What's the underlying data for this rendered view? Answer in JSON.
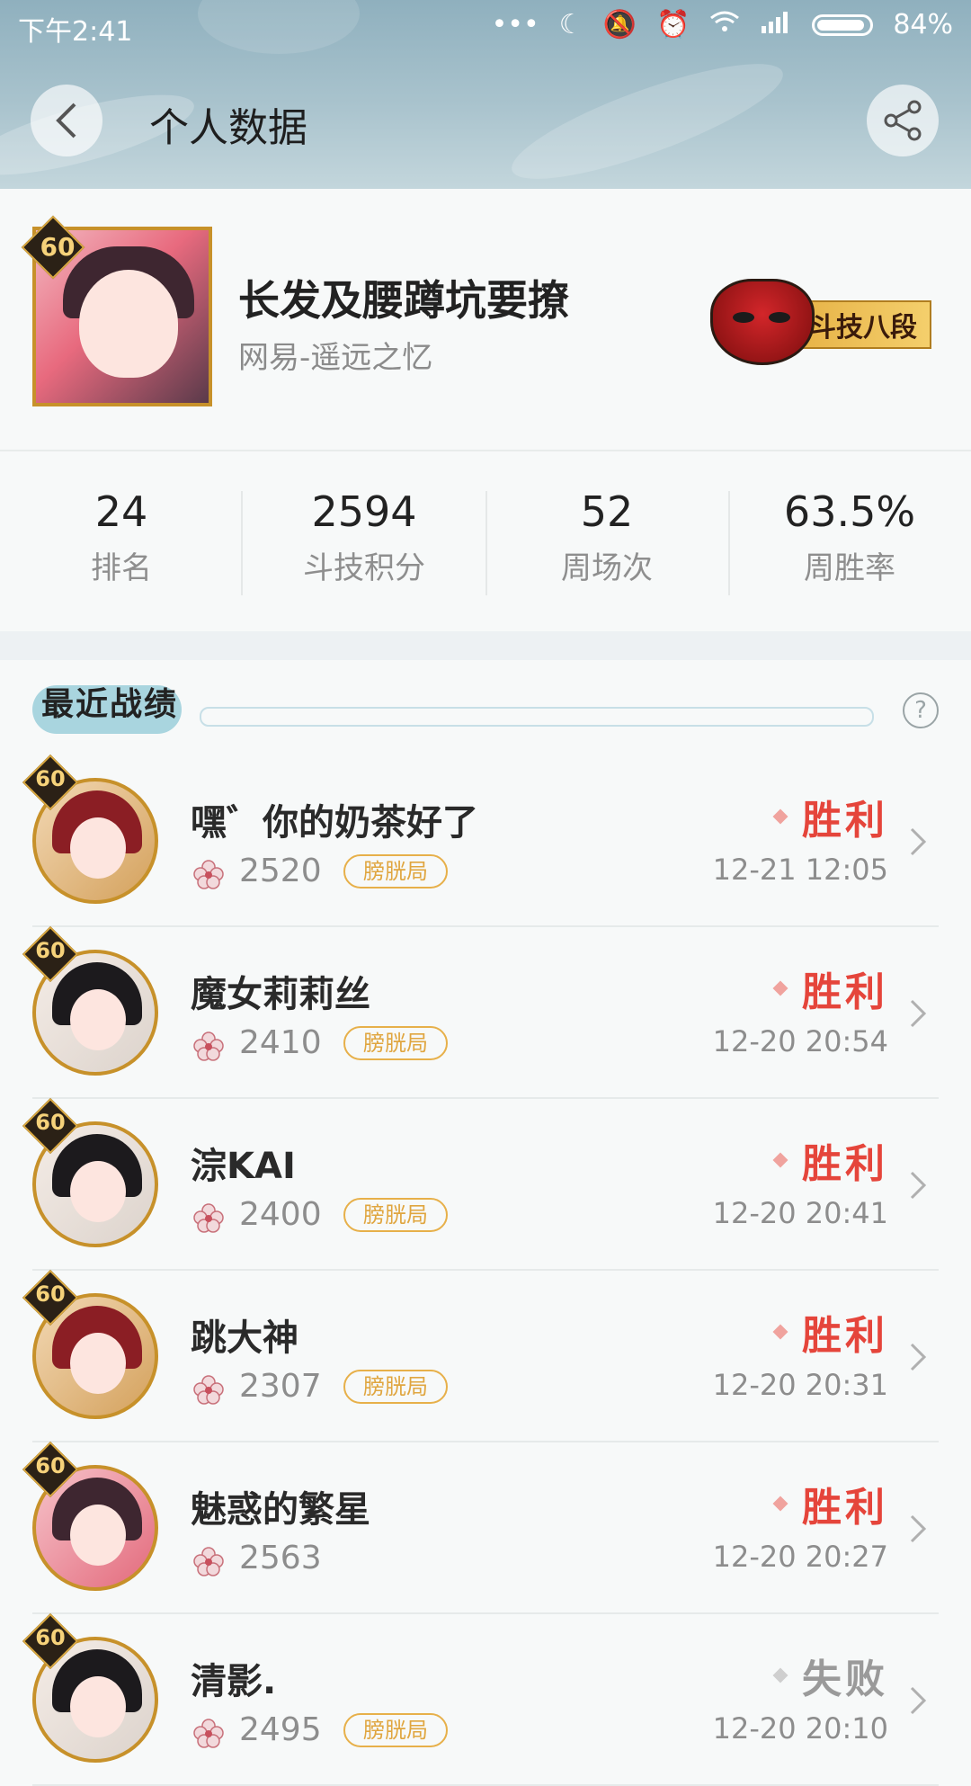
{
  "status_bar": {
    "time": "下午2:41",
    "battery": "84%"
  },
  "header": {
    "title": "个人数据"
  },
  "profile": {
    "level": "60",
    "name": "长发及腰蹲坑要撩",
    "server": "网易-遥远之忆",
    "rank": "斗技八段"
  },
  "stats": [
    {
      "value": "24",
      "label": "排名"
    },
    {
      "value": "2594",
      "label": "斗技积分"
    },
    {
      "value": "52",
      "label": "周场次"
    },
    {
      "value": "63.5%",
      "label": "周胜率"
    }
  ],
  "recent": {
    "title": "最近战绩",
    "help": "?"
  },
  "matches": [
    {
      "level": "60",
      "name": "嘿゛你的奶茶好了",
      "score": "2520",
      "tag": "膀胱局",
      "result": "胜利",
      "time": "12-21 12:05",
      "avatar": "swordsman"
    },
    {
      "level": "60",
      "name": "魔女莉莉丝",
      "score": "2410",
      "tag": "膀胱局",
      "result": "胜利",
      "time": "12-20 20:54",
      "avatar": "black-hair"
    },
    {
      "level": "60",
      "name": "淙KAI",
      "score": "2400",
      "tag": "膀胱局",
      "result": "胜利",
      "time": "12-20 20:41",
      "avatar": "black-hair"
    },
    {
      "level": "60",
      "name": "跳大神",
      "score": "2307",
      "tag": "膀胱局",
      "result": "胜利",
      "time": "12-20 20:31",
      "avatar": "swordsman"
    },
    {
      "level": "60",
      "name": "魅惑的繁星",
      "score": "2563",
      "tag": "",
      "result": "胜利",
      "time": "12-20 20:27",
      "avatar": "pink"
    },
    {
      "level": "60",
      "name": "清影.",
      "score": "2495",
      "tag": "膀胱局",
      "result": "失败",
      "time": "12-20 20:10",
      "avatar": "black-hair"
    }
  ],
  "colors": {
    "win": "#e5453b",
    "lose": "#9a9a9a",
    "accent_gold": "#c7912a",
    "tag": "#e0a640"
  },
  "icons": [
    "back-icon",
    "share-icon",
    "help-icon",
    "chevron-right-icon",
    "flower-icon",
    "rank-mask-icon"
  ]
}
